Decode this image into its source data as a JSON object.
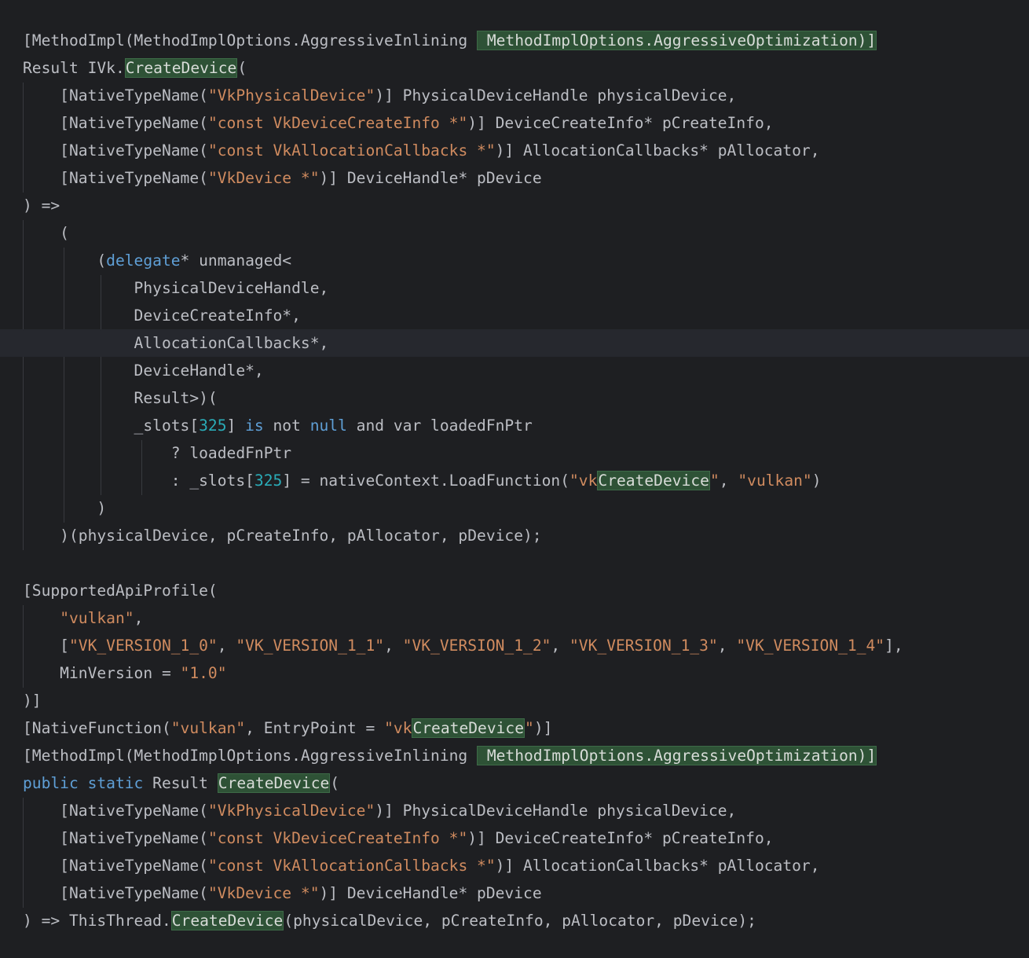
{
  "editor": {
    "lines": [
      "",
      "[MethodImpl(MethodImplOptions.AggressiveInlining | MethodImplOptions.AggressiveOptimization)]",
      "Result IVk.|CreateDevice|(",
      "    [NativeTypeName(\"VkPhysicalDevice\")] PhysicalDeviceHandle physicalDevice,",
      "    [NativeTypeName(\"const VkDeviceCreateInfo *\")] DeviceCreateInfo* pCreateInfo,",
      "    [NativeTypeName(\"const VkAllocationCallbacks *\")] AllocationCallbacks* pAllocator,",
      "    [NativeTypeName(\"VkDevice *\")] DeviceHandle* pDevice",
      ") =>",
      "    (",
      "        (delegate* unmanaged<",
      "            PhysicalDeviceHandle,",
      "            DeviceCreateInfo*,",
      "            AllocationCallbacks*,",
      "            DeviceHandle*,",
      "            Result>)(",
      "            _slots[325] is not null and var loadedFnPtr",
      "                ? loadedFnPtr",
      "                : _slots[325] = nativeContext.LoadFunction(\"vkCreateDevice\", \"vulkan\")",
      "        )",
      "    )(physicalDevice, pCreateInfo, pAllocator, pDevice);",
      "",
      "[SupportedApiProfile(",
      "    \"vulkan\",",
      "    [\"VK_VERSION_1_0\", \"VK_VERSION_1_1\", \"VK_VERSION_1_2\", \"VK_VERSION_1_3\", \"VK_VERSION_1_4\"],",
      "    MinVersion = \"1.0\"",
      ")]",
      "[NativeFunction(\"vulkan\", EntryPoint = \"vkCreateDevice\")]",
      "[MethodImpl(MethodImplOptions.AggressiveInlining | MethodImplOptions.AggressiveOptimization)]",
      "public static Result CreateDevice(",
      "    [NativeTypeName(\"VkPhysicalDevice\")] PhysicalDeviceHandle physicalDevice,",
      "    [NativeTypeName(\"const VkDeviceCreateInfo *\")] DeviceCreateInfo* pCreateInfo,",
      "    [NativeTypeName(\"const VkAllocationCallbacks *\")] AllocationCallbacks* pAllocator,",
      "    [NativeTypeName(\"VkDevice *\")] DeviceHandle* pDevice",
      ") => ThisThread.CreateDevice(physicalDevice, pCreateInfo, pAllocator, pDevice);"
    ],
    "highlighted_identifier": "CreateDevice",
    "colors": {
      "background": "#1e1f22",
      "current_line": "#26282e",
      "text": "#bcbec4",
      "string": "#d08b5f",
      "keyword": "#5f9fd6",
      "number": "#2aacb8",
      "match_highlight": "#2e5236"
    }
  }
}
